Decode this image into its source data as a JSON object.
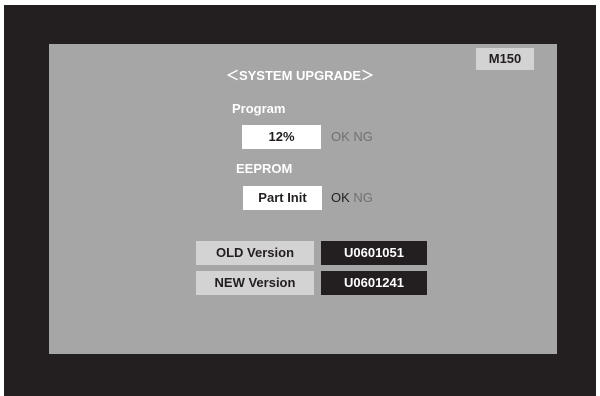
{
  "model": "M150",
  "title": "＜SYSTEM UPGRADE＞",
  "program": {
    "label": "Program",
    "value": "12%",
    "ok": "OK",
    "ng": "NG"
  },
  "eeprom": {
    "label": "EEPROM",
    "value": "Part Init",
    "ok": "OK",
    "ng": "NG"
  },
  "versions": {
    "old_label": "OLD Version",
    "old_value": "U0601051",
    "new_label": "NEW Version",
    "new_value": "U0601241"
  },
  "colors": {
    "frame": "#231f20",
    "panel": "#a6a6a6",
    "label_box": "#d3d3d3",
    "value_box": "#231f20"
  }
}
